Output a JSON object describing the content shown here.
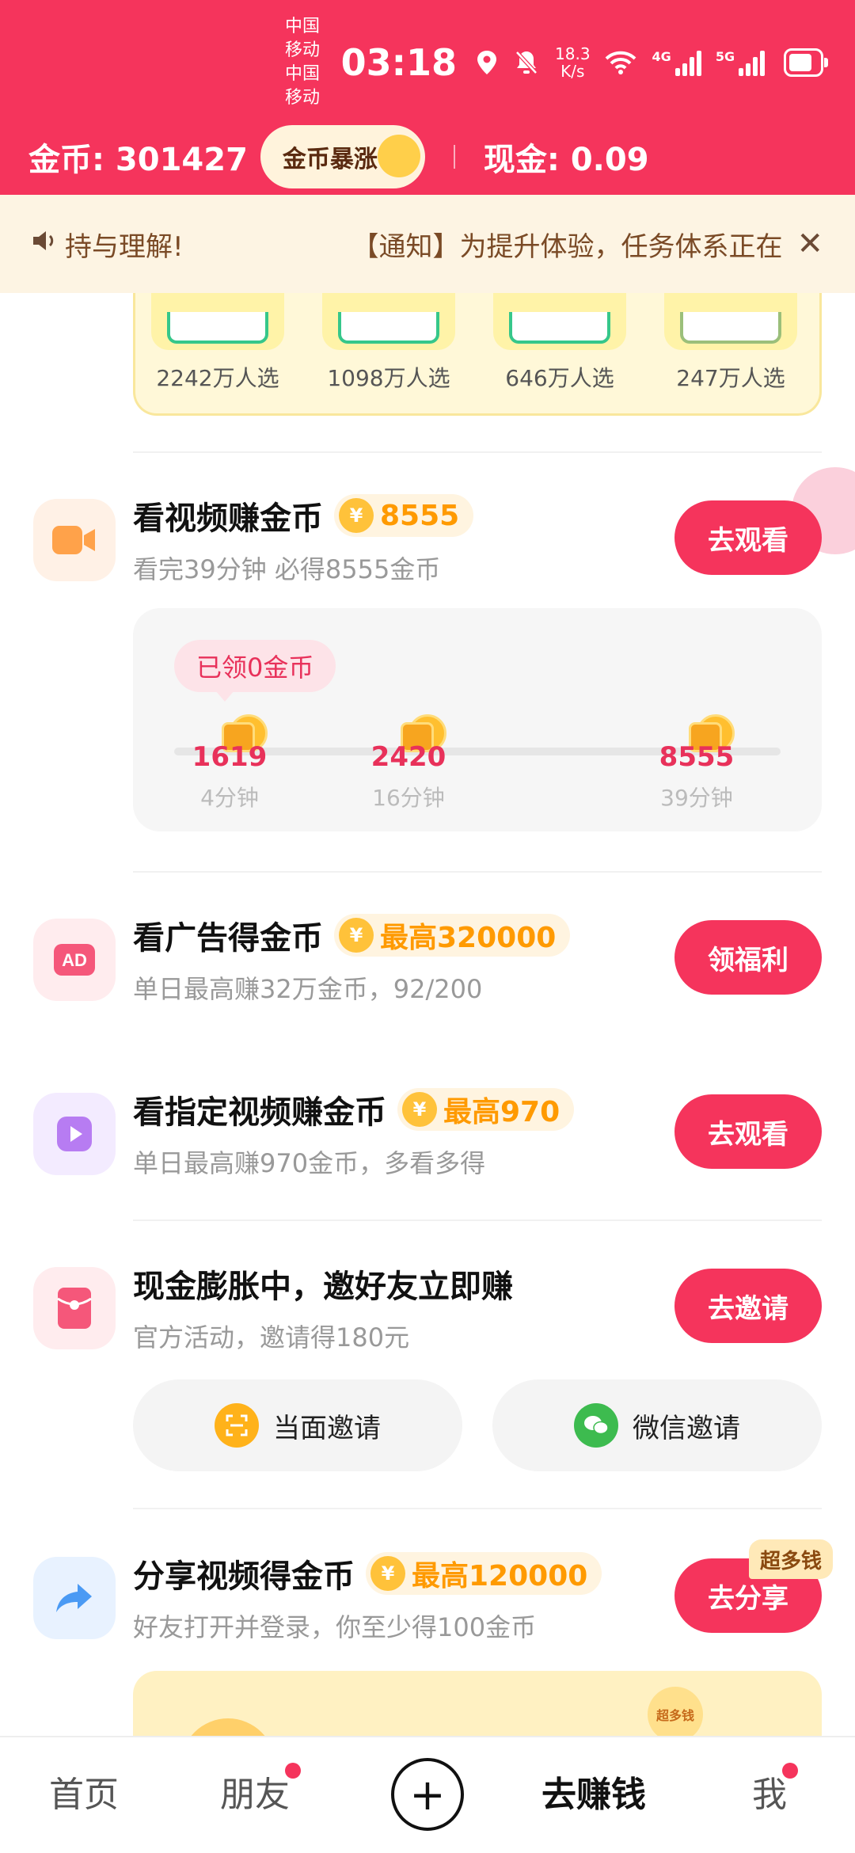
{
  "status_bar": {
    "carrier1": "中国移动",
    "carrier2": "中国移动",
    "time": "03:18",
    "net_speed_value": "18.3",
    "net_speed_unit": "K/s",
    "net1": "4G",
    "net2": "5G"
  },
  "wallet": {
    "coins_text": "金币: 301427",
    "surge_label": "金币暴涨",
    "cash_text": "现金: 0.09"
  },
  "notice": {
    "left_text": "持与理解!",
    "right_text": "【通知】为提升体验，任务体系正在",
    "close_icon": "close-icon"
  },
  "goods": [
    {
      "label": "2242万人选"
    },
    {
      "label": "1098万人选"
    },
    {
      "label": "646万人选"
    },
    {
      "label": "247万人选"
    }
  ],
  "tasks": {
    "video": {
      "title": "看视频赚金币",
      "reward": "8555",
      "sub": "看完39分钟 必得8555金币",
      "button": "去观看",
      "icon": "video-camera-icon"
    },
    "ad": {
      "title": "看广告得金币",
      "reward": "最高320000",
      "sub": "单日最高赚32万金币，92/200",
      "button": "领福利",
      "icon": "ad-icon"
    },
    "assigned": {
      "title": "看指定视频赚金币",
      "reward": "最高970",
      "sub": "单日最高赚970金币，多看多得",
      "button": "去观看",
      "icon": "play-icon"
    },
    "invite": {
      "title": "现金膨胀中，邀好友立即赚",
      "sub": "官方活动，邀请得180元",
      "button": "去邀请",
      "icon": "red-envelope-icon"
    },
    "share": {
      "title": "分享视频得金币",
      "reward": "最高120000",
      "sub": "好友打开并登录，你至少得100金币",
      "button": "去分享",
      "tag": "超多钱",
      "icon": "share-arrow-icon"
    }
  },
  "progress": {
    "collected": "已领0金币",
    "milestones": [
      {
        "value": "1619",
        "time": "4分钟"
      },
      {
        "value": "2420",
        "time": "16分钟"
      },
      {
        "value": "8555",
        "time": "39分钟"
      }
    ]
  },
  "invite_buttons": {
    "face": "当面邀请",
    "wechat": "微信邀请"
  },
  "banner": {
    "stamp": "超多钱"
  },
  "tabbar": {
    "home": "首页",
    "friends": "朋友",
    "earn": "去赚钱",
    "me": "我"
  }
}
